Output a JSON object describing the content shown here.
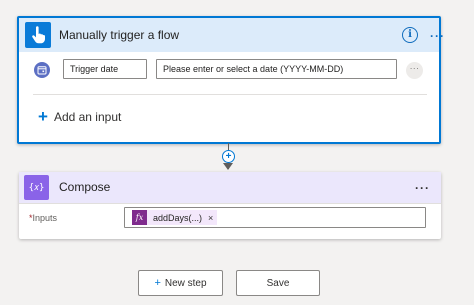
{
  "trigger": {
    "title": "Manually trigger a flow",
    "icon": "hand-touch-icon",
    "accent_color": "#0078d4",
    "header_bg": "#dcebfa",
    "more": "···",
    "params": {
      "name_value": "Trigger date",
      "placeholder_value": "Please enter or select a date (YYYY-MM-DD)",
      "more": "···"
    },
    "add_input_icon": "+",
    "add_input_label": "Add an input"
  },
  "connector": {
    "plus": "+"
  },
  "compose": {
    "title": "Compose",
    "icon_glyph": "{𝑥}",
    "icon_color": "#8a63e8",
    "more": "···",
    "inputs": {
      "required_mark": "*",
      "label": "Inputs",
      "token_badge": "fx",
      "token_label": "addDays(...)",
      "token_remove": "×"
    }
  },
  "footer": {
    "new_step_icon": "+",
    "new_step_label": "New step",
    "save_label": "Save"
  }
}
